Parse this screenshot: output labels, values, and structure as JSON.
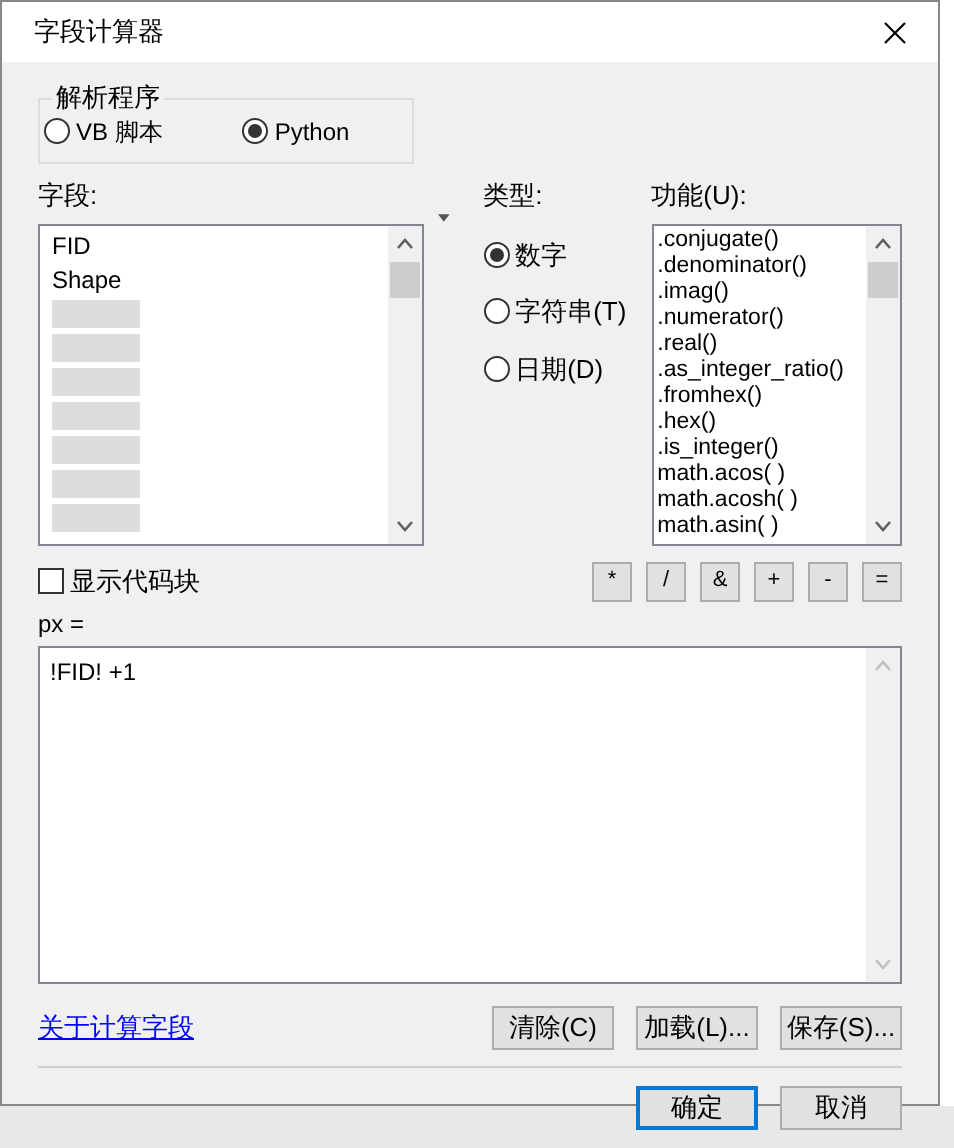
{
  "window": {
    "title": "字段计算器"
  },
  "parser": {
    "label": "解析程序",
    "options": [
      {
        "label": "VB 脚本",
        "selected": false
      },
      {
        "label": "Python",
        "selected": true
      }
    ]
  },
  "fields": {
    "label": "字段:",
    "items": [
      "FID",
      "Shape"
    ]
  },
  "type": {
    "label": "类型:",
    "options": [
      {
        "label": "数字",
        "selected": true
      },
      {
        "label": "字符串(T)",
        "selected": false
      },
      {
        "label": "日期(D)",
        "selected": false
      }
    ]
  },
  "functions": {
    "label": "功能(U):",
    "items": [
      ".conjugate()",
      ".denominator()",
      ".imag()",
      ".numerator()",
      ".real()",
      ".as_integer_ratio()",
      ".fromhex()",
      ".hex()",
      ".is_integer()",
      "math.acos( )",
      "math.acosh( )",
      "math.asin( )"
    ]
  },
  "show_codeblock": {
    "label": "显示代码块",
    "checked": false
  },
  "operators": [
    "*",
    "/",
    "&",
    "+",
    "-",
    "="
  ],
  "expression": {
    "label": "px =",
    "value": "!FID! +1"
  },
  "about_link": "关于计算字段",
  "file_buttons": [
    "清除(C)",
    "加载(L)...",
    "保存(S)..."
  ],
  "dialog_buttons": [
    {
      "label": "确定",
      "default": true
    },
    {
      "label": "取消",
      "default": false
    }
  ]
}
